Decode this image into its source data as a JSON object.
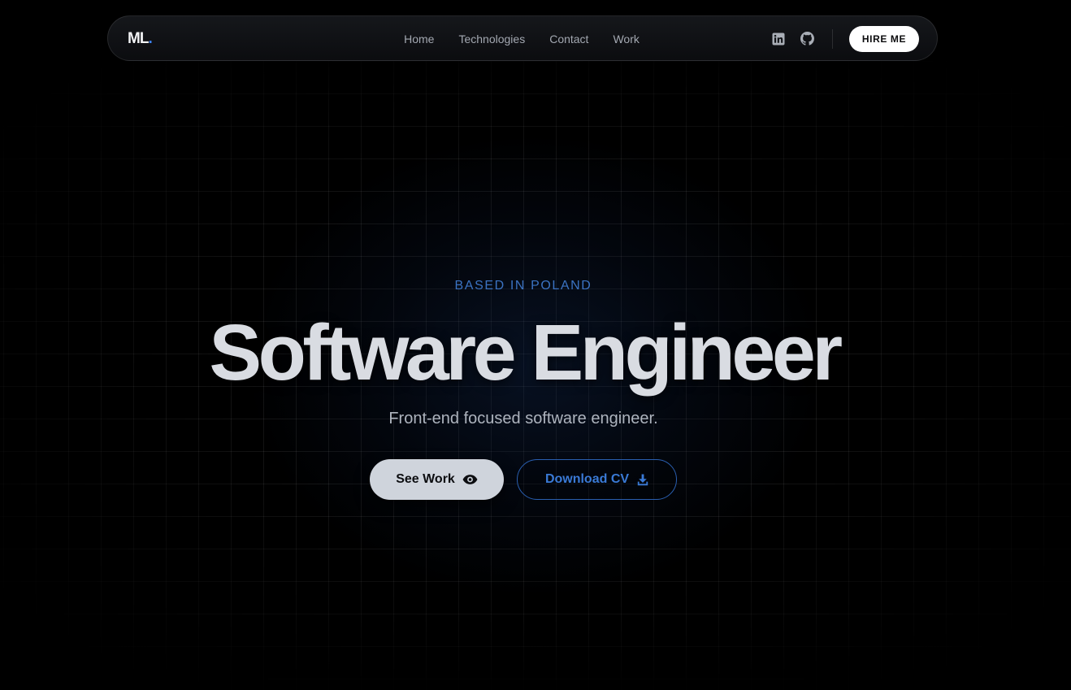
{
  "navbar": {
    "logo_text": "ML",
    "logo_dot": ".",
    "links": [
      "Home",
      "Technologies",
      "Contact",
      "Work"
    ],
    "social_icons": [
      "linkedin-icon",
      "github-icon"
    ],
    "cta_label": "HIRE ME"
  },
  "hero": {
    "kicker": "BASED IN POLAND",
    "title": "Software Engineer",
    "subtitle": "Front-end focused software engineer.",
    "primary_button": {
      "label": "See Work",
      "icon": "eye-icon"
    },
    "secondary_button": {
      "label": "Download CV",
      "icon": "download-icon"
    }
  },
  "colors": {
    "background": "#000000",
    "accent": "#3b82f6",
    "title": "#d9dce2",
    "primary_button_bg": "#cfd4dc",
    "secondary_button_border": "#2a5fb0"
  }
}
